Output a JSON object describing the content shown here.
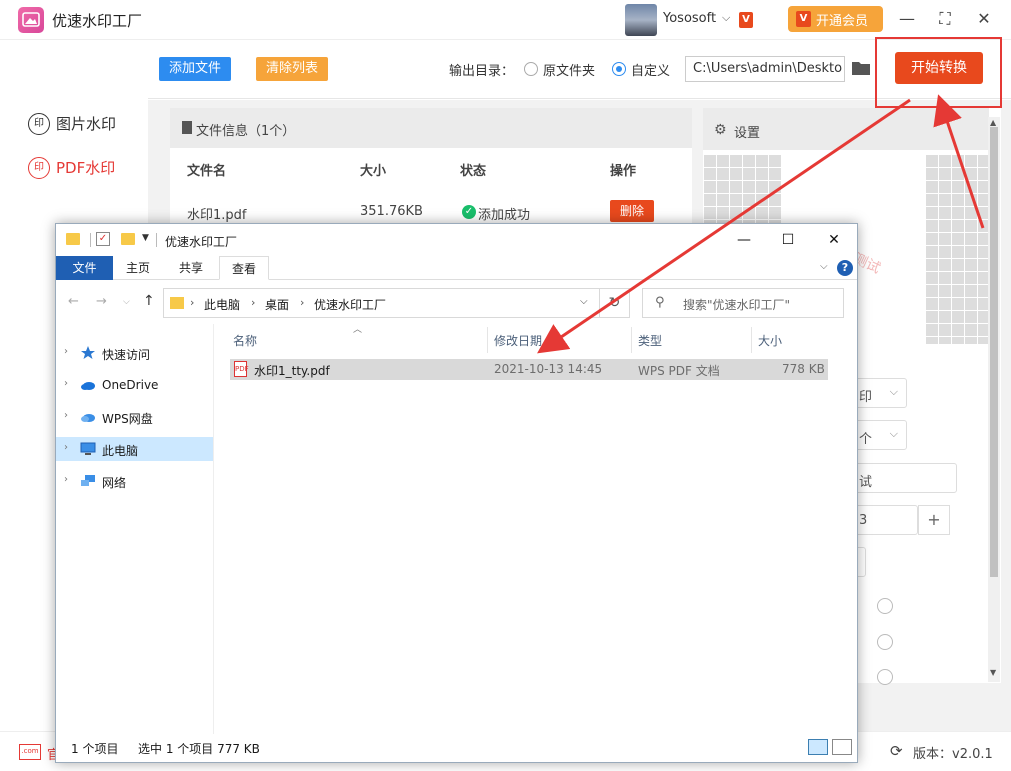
{
  "app": {
    "title": "优速水印工厂",
    "username": "Yososoft",
    "vip_badge": "V",
    "member_button": "开通会员",
    "window_controls": {
      "minimize": "—",
      "maximize": "⛶",
      "close": "✕"
    }
  },
  "sidebar": {
    "items": [
      {
        "icon_text": "印",
        "label": "图片水印",
        "active": false
      },
      {
        "icon_text": "印",
        "label": "PDF水印",
        "active": true
      }
    ]
  },
  "toolbar": {
    "add_files": "添加文件",
    "clear_list": "清除列表",
    "output_label": "输出目录：",
    "radio_original": "原文件夹",
    "radio_custom": "自定义",
    "selected_output": "自定义",
    "output_path": "C:\\Users\\admin\\Deskto",
    "start_button": "开始转换"
  },
  "file_panel": {
    "header": "文件信息（1个）",
    "columns": [
      "文件名",
      "大小",
      "状态",
      "操作"
    ],
    "rows": [
      {
        "name": "水印1.pdf",
        "size": "351.76KB",
        "status": "添加成功",
        "action": "删除"
      }
    ]
  },
  "settings": {
    "header": "设置",
    "watermark_preview_text": "测试",
    "fields": {
      "select1_tail": "印",
      "select2_tail": "个",
      "text_tail": "试",
      "number_tail": "3",
      "plus": "+"
    }
  },
  "footer": {
    "com_icon": ".com",
    "left_label": "官",
    "version": "版本：v2.0.1"
  },
  "explorer": {
    "title": "优速水印工厂",
    "window_controls": {
      "minimize": "—",
      "maximize": "☐",
      "close": "✕"
    },
    "ribbon": {
      "file": "文件",
      "tabs": [
        "主页",
        "共享",
        "查看"
      ],
      "active_tab": "查看"
    },
    "address": {
      "crumbs": [
        "此电脑",
        "桌面",
        "优速水印工厂"
      ]
    },
    "search_placeholder": "搜索\"优速水印工厂\"",
    "nav": [
      {
        "label": "快速访问",
        "icon": "star-icon",
        "selected": false
      },
      {
        "label": "OneDrive",
        "icon": "cloud-icon",
        "selected": false
      },
      {
        "label": "WPS网盘",
        "icon": "cloud-icon",
        "selected": false
      },
      {
        "label": "此电脑",
        "icon": "computer-icon",
        "selected": true
      },
      {
        "label": "网络",
        "icon": "network-icon",
        "selected": false
      }
    ],
    "columns": [
      "名称",
      "修改日期",
      "类型",
      "大小"
    ],
    "files": [
      {
        "name": "水印1_tty.pdf",
        "modified": "2021-10-13 14:45",
        "type": "WPS PDF 文档",
        "size": "778 KB"
      }
    ],
    "status": {
      "count": "1 个项目",
      "selected": "选中 1 个项目  777 KB"
    }
  },
  "colors": {
    "accent_red": "#e8491d",
    "accent_blue": "#2d8cf0",
    "accent_orange": "#f6a43a",
    "annotation_red": "#e53935",
    "explorer_blue": "#1f5fb3"
  }
}
